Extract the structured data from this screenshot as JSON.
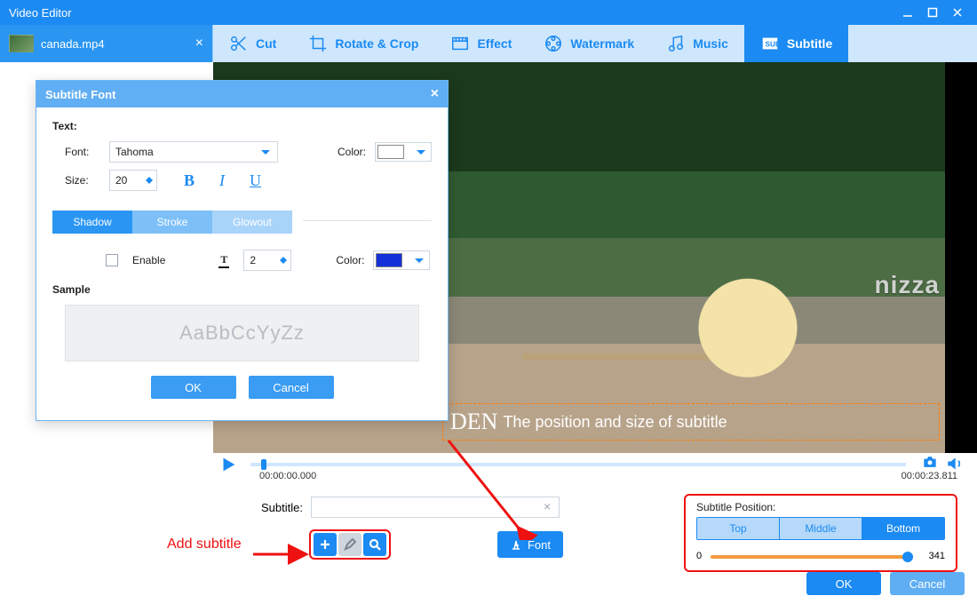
{
  "window": {
    "title": "Video Editor"
  },
  "file": {
    "name": "canada.mp4"
  },
  "tabs": {
    "cut": "Cut",
    "rotate": "Rotate & Crop",
    "effect": "Effect",
    "watermark": "Watermark",
    "music": "Music",
    "subtitle": "Subtitle"
  },
  "preview": {
    "pizza_sign": "nizza",
    "subtitle_overlay_prefix": "DEN",
    "subtitle_overlay": "The position and size of subtitle"
  },
  "timeline": {
    "current": "00:00:00.000",
    "duration": "00:00:23.811"
  },
  "subtitle_row": {
    "label": "Subtitle:",
    "value": "",
    "font_btn": "Font"
  },
  "annotations": {
    "add_subtitle": "Add subtitle"
  },
  "position_panel": {
    "heading": "Subtitle Position:",
    "options": {
      "top": "Top",
      "middle": "Middle",
      "bottom": "Bottom"
    },
    "slider": {
      "min": "0",
      "value": "341"
    }
  },
  "bottom": {
    "ok": "OK",
    "cancel": "Cancel"
  },
  "dialog": {
    "title": "Subtitle Font",
    "section_text": "Text:",
    "font_label": "Font:",
    "font_value": "Tahoma",
    "color_label": "Color:",
    "text_color": "#ffffff",
    "size_label": "Size:",
    "size_value": "20",
    "effects": {
      "shadow": "Shadow",
      "stroke": "Stroke",
      "glowout": "Glowout"
    },
    "enable_label": "Enable",
    "thickness_value": "2",
    "effect_color_label": "Color:",
    "effect_color": "#1430d8",
    "sample_label": "Sample",
    "sample_text": "AaBbCcYyZz",
    "ok": "OK",
    "cancel": "Cancel"
  }
}
